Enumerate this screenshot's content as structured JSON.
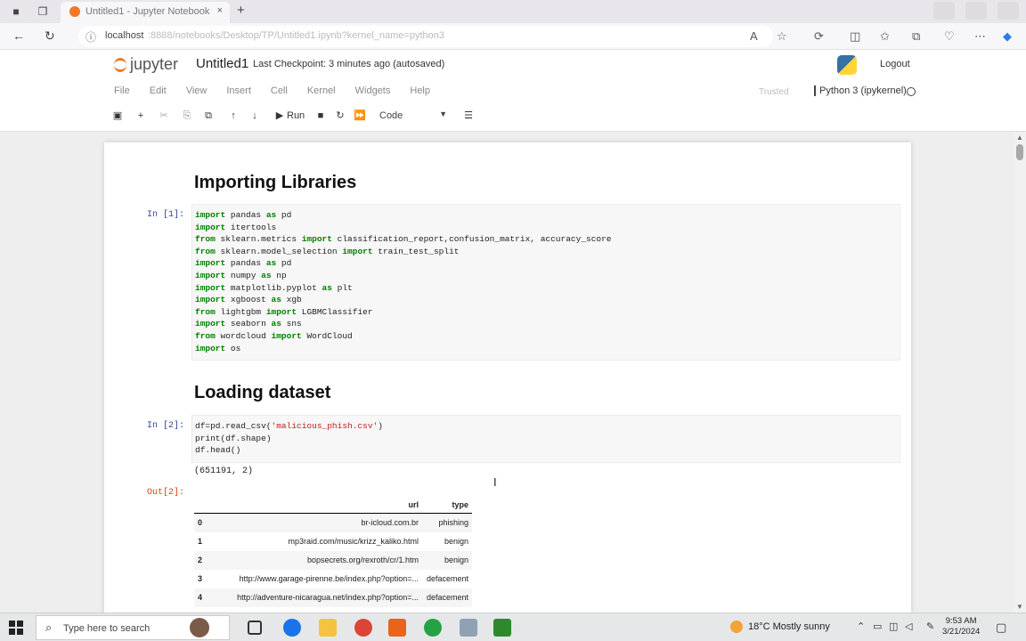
{
  "browser": {
    "tab_title": "Untitled1 - Jupyter Notebook",
    "tab_close": "×",
    "new_tab": "+",
    "url_host": "localhost",
    "url_path": ":8888/notebooks/Desktop/TP/Untitled1.ipynb?kernel_name=python3"
  },
  "jupyter": {
    "logo_text": "jupyter",
    "notebook_name": "Untitled1",
    "checkpoint": "Last Checkpoint: 3 minutes ago  (autosaved)",
    "logout": "Logout",
    "menu": [
      "File",
      "Edit",
      "View",
      "Insert",
      "Cell",
      "Kernel",
      "Widgets",
      "Help"
    ],
    "trusted": "Trusted",
    "kernel": "Python 3 (ipykernel)",
    "run_label": "Run",
    "cell_type": "Code"
  },
  "notebook": {
    "heading1": "Importing Libraries",
    "prompt1": "In [1]:",
    "code1": [
      "import pandas as pd",
      "import itertools",
      "from sklearn.metrics import classification_report,confusion_matrix, accuracy_score",
      "from sklearn.model_selection import train_test_split",
      "import pandas as pd",
      "import numpy as np",
      "import matplotlib.pyplot as plt",
      "import xgboost as xgb",
      "from lightgbm import LGBMClassifier",
      "import seaborn as sns",
      "from wordcloud import WordCloud",
      "import os"
    ],
    "heading2": "Loading dataset",
    "prompt2": "In [2]:",
    "code2": [
      "df=pd.read_csv('malicious_phish.csv')",
      "print(df.shape)",
      "df.head()"
    ],
    "stdout2": "(651191, 2)",
    "out_prompt": "Out[2]:",
    "table": {
      "columns": [
        "",
        "url",
        "type"
      ],
      "rows": [
        [
          "0",
          "br-icloud.com.br",
          "phishing"
        ],
        [
          "1",
          "mp3raid.com/music/krizz_kaliko.html",
          "benign"
        ],
        [
          "2",
          "bopsecrets.org/rexroth/cr/1.htm",
          "benign"
        ],
        [
          "3",
          "http://www.garage-pirenne.be/index.php?option=...",
          "defacement"
        ],
        [
          "4",
          "http://adventure-nicaragua.net/index.php?option=...",
          "defacement"
        ]
      ]
    }
  },
  "taskbar": {
    "search_placeholder": "Type here to search",
    "weather": "18°C  Mostly sunny",
    "time": "9:53 AM",
    "date": "3/21/2024"
  },
  "colors": {
    "jupyter_orange": "#f37726",
    "prompt_in": "#303f9f",
    "prompt_out": "#d84315",
    "keyword": "#008000",
    "string": "#ba2121"
  }
}
